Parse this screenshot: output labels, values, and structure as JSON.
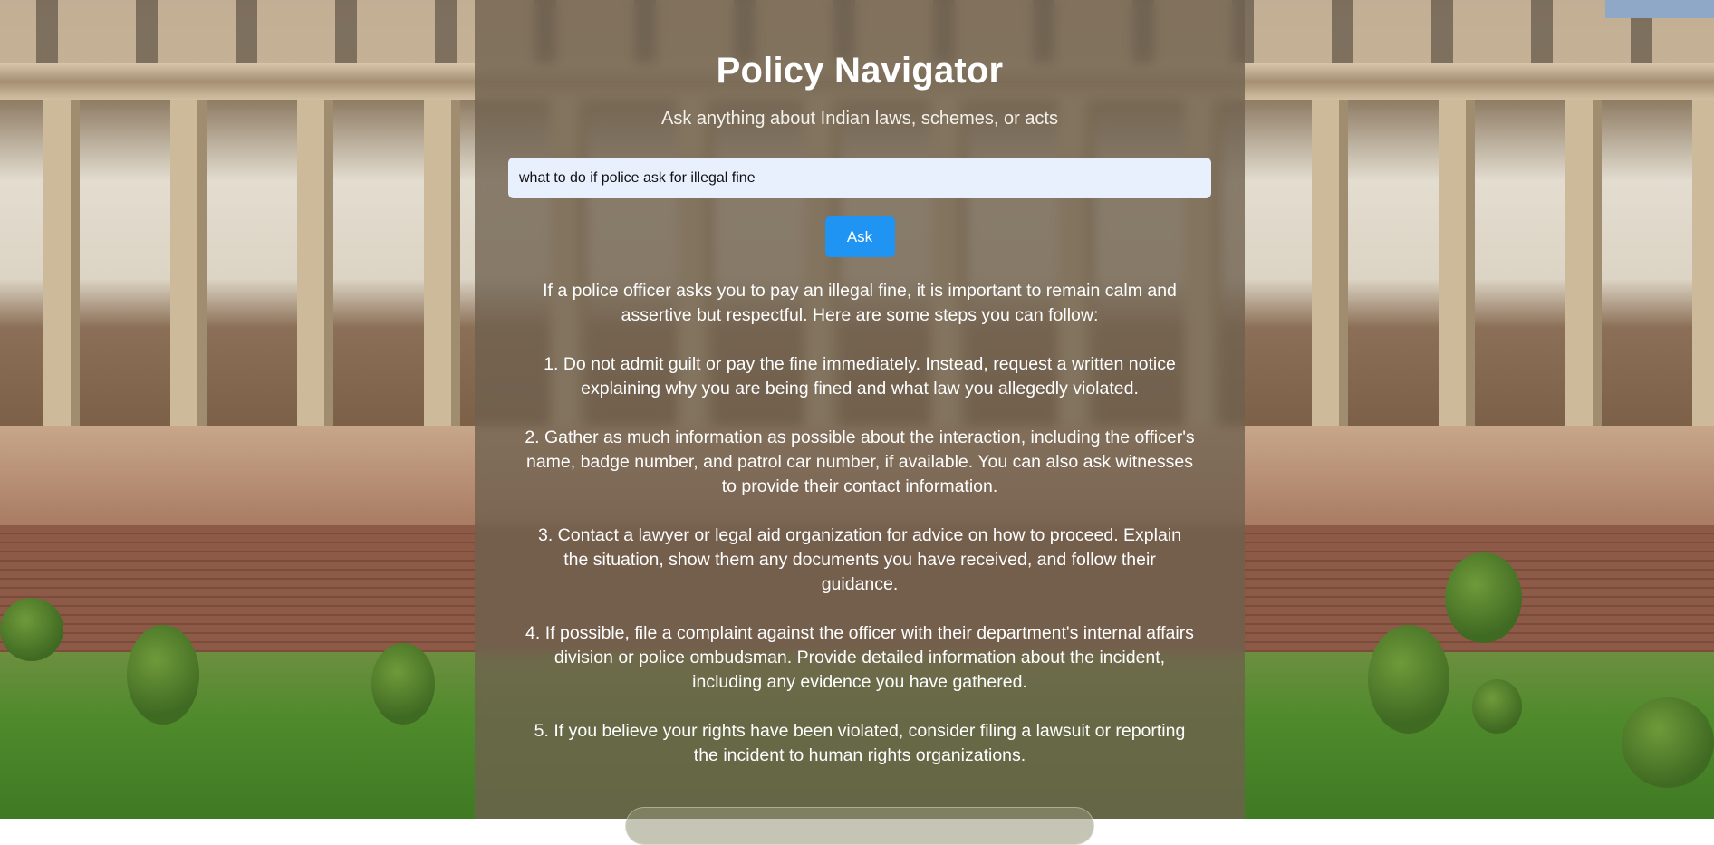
{
  "app": {
    "title": "Policy Navigator",
    "subtitle": "Ask anything about Indian laws, schemes, or acts"
  },
  "search": {
    "value": "what to do if police ask for illegal fine",
    "button_label": "Ask"
  },
  "answer": {
    "paragraphs": [
      "If a police officer asks you to pay an illegal fine, it is important to remain calm and assertive but respectful. Here are some steps you can follow:",
      "1. Do not admit guilt or pay the fine immediately. Instead, request a written notice explaining why you are being fined and what law you allegedly violated.",
      "2. Gather as much information as possible about the interaction, including the officer's name, badge number, and patrol car number, if available. You can also ask witnesses to provide their contact information.",
      "3. Contact a lawyer or legal aid organization for advice on how to proceed. Explain the situation, show them any documents you have received, and follow their guidance.",
      "4. If possible, file a complaint against the officer with their department's internal affairs division or police ombudsman. Provide detailed information about the incident, including any evidence you have gathered.",
      "5. If you believe your rights have been violated, consider filing a lawsuit or reporting the incident to human rights organizations."
    ]
  },
  "colors": {
    "accent": "#1f94f2",
    "input_bg": "#e8effd",
    "panel_overlay": "#6e604e"
  }
}
